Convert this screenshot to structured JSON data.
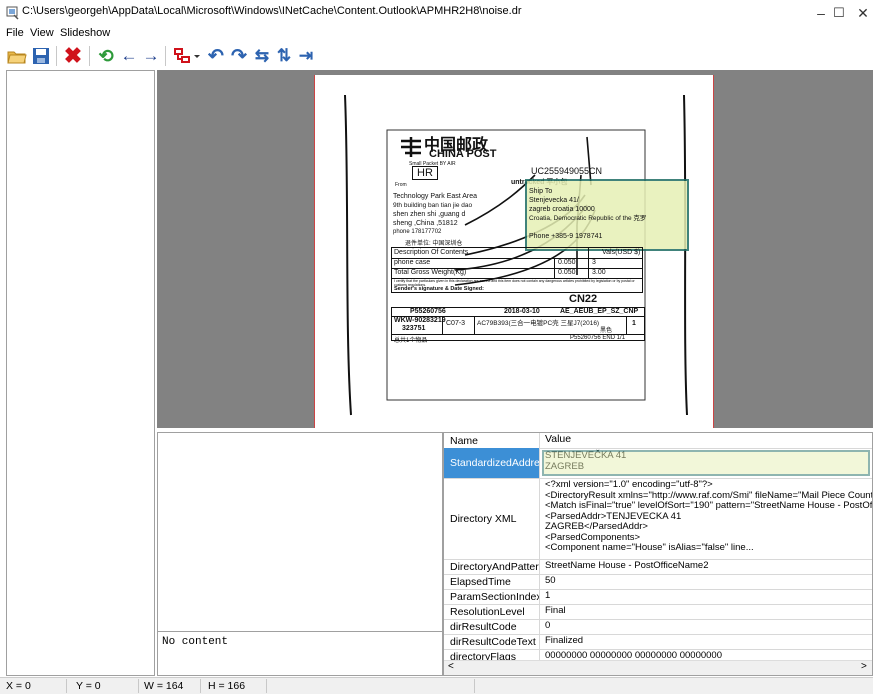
{
  "window": {
    "title": "C:\\Users\\georgeh\\AppData\\Local\\Microsoft\\Windows\\INetCache\\Content.Outlook\\APMHR2H8\\noise.dr",
    "minimize": "–",
    "maximize": "☐",
    "close": "✕"
  },
  "menu": [
    "File",
    "View",
    "Slideshow"
  ],
  "toolbar_icons": [
    "open-folder-icon",
    "save-icon",
    "delete-icon",
    "refresh-icon",
    "arrow-left-icon",
    "arrow-right-icon",
    "crop-icon",
    "undo-icon",
    "redo-icon",
    "swap-horizontal-icon",
    "swap-vertical-icon",
    "fit-width-icon"
  ],
  "label_image": {
    "logo_cn": "中国邮政",
    "logo_en": "CHINA POST",
    "small_packet": "Small Packet BY AIR",
    "country": "HR",
    "tracking": "UC255949055CN",
    "untracked": "untracked 平小包",
    "from": "From",
    "sender_lines": [
      "Technology Park East Area",
      "9th building ban tian jie dao",
      "shen zhen shi ,guang d",
      "sheng ,China ,51812",
      "phone 178177702"
    ],
    "return_cn": "退件单位: 中国深圳仓",
    "ship_to": "Ship To",
    "address_lines": [
      "Stenjevecka 41/",
      "zagreb croatia 10000",
      "Croatia, Democratic Republic of the 克罗",
      "",
      "Phone +385-9 1978741"
    ],
    "contents_header": "Description Of Contents",
    "vals_header": "Vals(USD $)",
    "item": "phone case",
    "item_weight": "0.050",
    "item_value": "3",
    "total_label": "Total Gross Weight(Kg)",
    "total_weight": "0.050",
    "total_value": "3.00",
    "declaration": "I certify that the particulars given in this declaration are correct and this item does not contain any dangerous articles prohibited by legislation or by postal or customs regulations.",
    "signature": "Sender's signature & Date Signed:",
    "cn22": "CN22",
    "ref": "P55260756",
    "date": "2018-03-10",
    "route": "AE_AEUB_EP_SZ_CNP",
    "wkw": "WKW-90283219",
    "wkw2": "323751",
    "c07": "C07-3",
    "sku": "AC79B393(三合一电镀PC壳 三星J7(2016)",
    "color": "黑色",
    "qty": "1",
    "footer_left": "总共1个物品",
    "footer_right": "P55260756 END 1/1"
  },
  "left_bottom": {
    "no_content": "No content"
  },
  "grid": {
    "header_name": "Name",
    "header_value": "Value",
    "rows": [
      {
        "name": "StandardizedAddress",
        "value": "STENJEVEČKA 41\nZAGREB"
      },
      {
        "name": "Directory XML",
        "value": "<?xml version=\"1.0\" encoding=\"utf-8\"?>\n<DirectoryResult xmlns=\"http://www.raf.com/Smi\" fileName=\"Mail Piece Count: 29!\n<Match isFinal=\"true\" levelOfSort=\"190\" pattern=\"StreetName House - PostOfficeN\n<ParsedAddr>TENJEVECKA 41\nZAGREB</ParsedAddr>\n<ParsedComponents>\n<Component name=\"House\" isAlias=\"false\" line..."
      },
      {
        "name": "DirectoryAndPattern",
        "value": "StreetName House - PostOfficeName2"
      },
      {
        "name": "ElapsedTime",
        "value": "50"
      },
      {
        "name": "ParamSectionIndex",
        "value": "1"
      },
      {
        "name": "ResolutionLevel",
        "value": "Final"
      },
      {
        "name": "dirResultCode",
        "value": "0"
      },
      {
        "name": "dirResultCodeText",
        "value": "Finalized"
      },
      {
        "name": "directoryFlags",
        "value": "00000000 00000000 00000000 00000000"
      }
    ],
    "scroll_left": "<",
    "scroll_right": ">"
  },
  "status": {
    "x": "X = 0",
    "y": "Y = 0",
    "w": "W = 164",
    "h": "H = 166"
  },
  "colors": {
    "highlight_border": "#1f6e64",
    "highlight_fill": "#e6f0b4",
    "selection": "#3c8fd6",
    "viewer_bg": "#828282"
  }
}
